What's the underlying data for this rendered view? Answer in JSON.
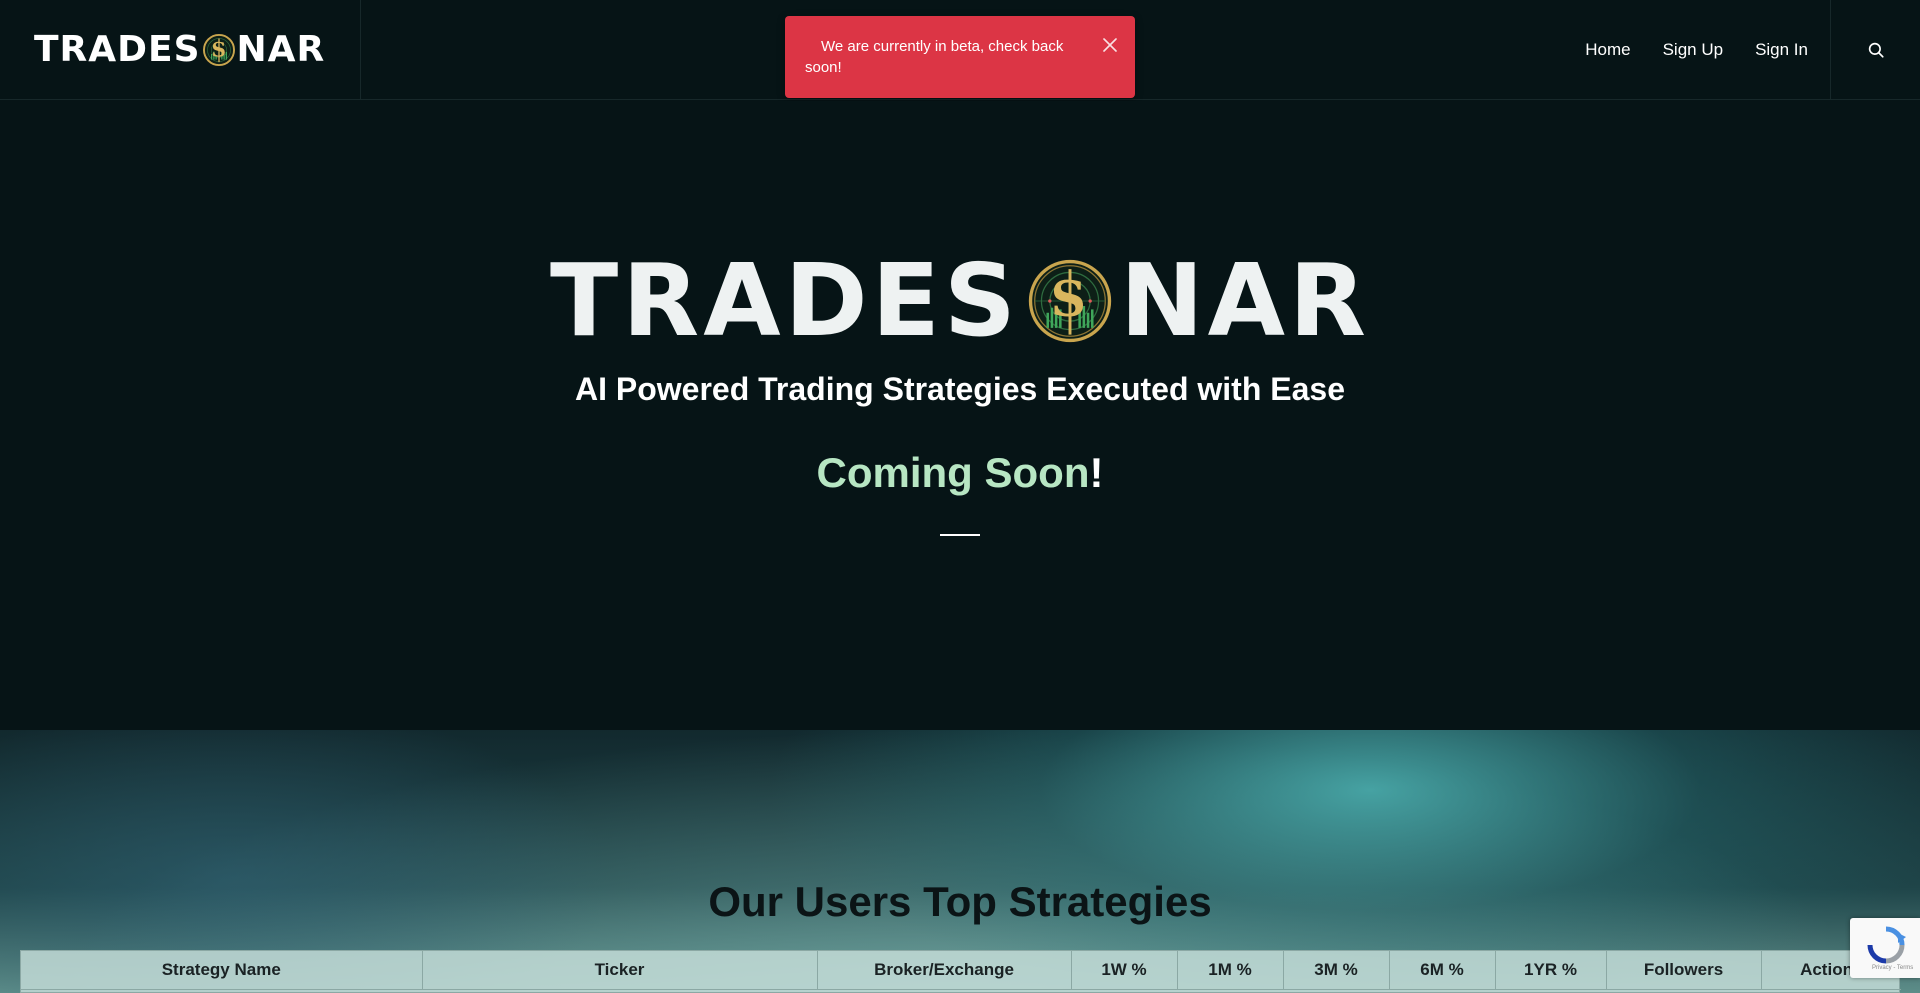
{
  "header": {
    "logo_left": "TRADES",
    "logo_right": "NAR",
    "nav": [
      {
        "label": "Home"
      },
      {
        "label": "Sign Up"
      },
      {
        "label": "Sign In"
      }
    ],
    "search_icon": "search-icon"
  },
  "toast": {
    "message": "We are currently in beta, check back soon!",
    "close_icon": "close-icon",
    "color": "#dc3545"
  },
  "hero": {
    "logo_left": "TRADES",
    "logo_right": "NAR",
    "tagline": "AI Powered Trading Strategies Executed with Ease",
    "coming_text": "Coming Soon",
    "coming_punct": "!",
    "accent_color": "#b7e6c3"
  },
  "strategies": {
    "title": "Our Users Top Strategies",
    "columns": [
      "Strategy Name",
      "Ticker",
      "Broker/Exchange",
      "1W %",
      "1M %",
      "3M %",
      "6M %",
      "1YR %",
      "Followers",
      "Actions"
    ]
  },
  "recaptcha": {
    "terms": "Privacy - Terms",
    "icon": "recaptcha-icon"
  },
  "colors": {
    "background": "#061416",
    "emblem_gold": "#c9a54e",
    "emblem_green": "#3fa65a"
  }
}
